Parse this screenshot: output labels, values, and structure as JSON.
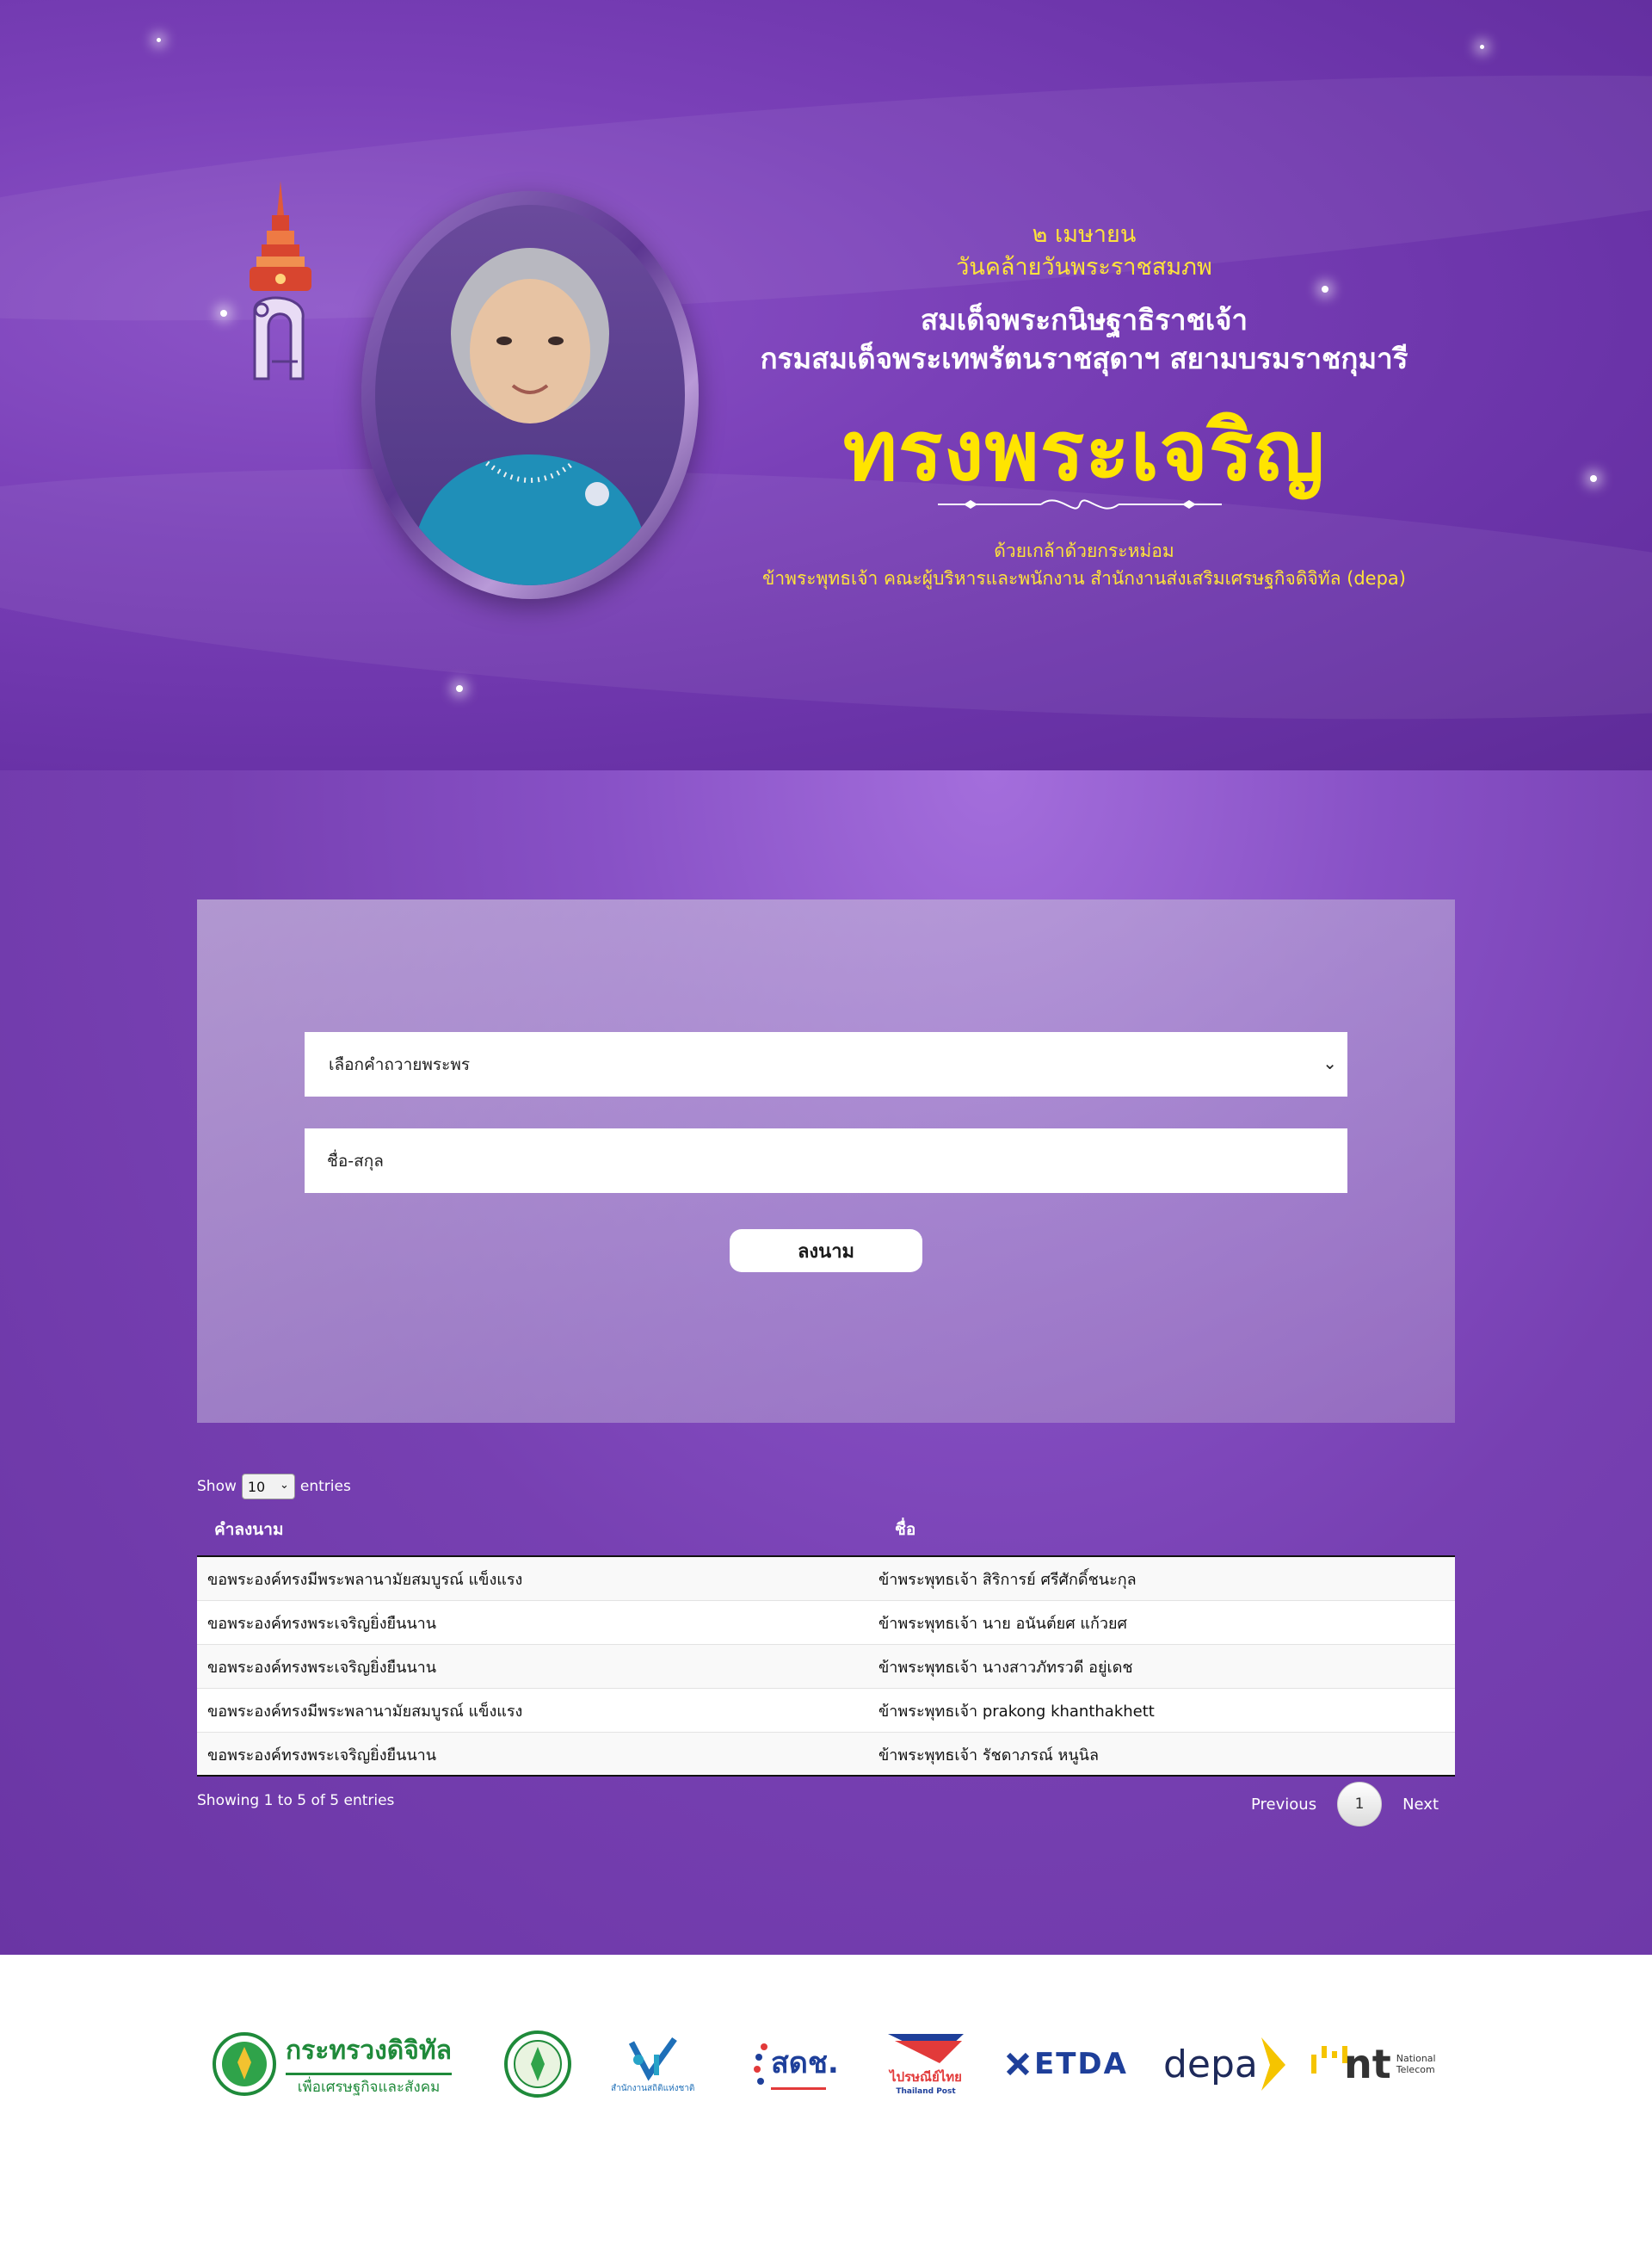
{
  "hero": {
    "date": "๒ เมษายน",
    "occasion": "วันคล้ายวันพระราชสมภพ",
    "name_line1": "สมเด็จพระกนิษฐาธิราชเจ้า",
    "name_line2": "กรมสมเด็จพระเทพรัตนราชสุดาฯ สยามบรมราชกุมารี",
    "main_title": "ทรงพระเจริญ",
    "dedication_line1": "ด้วยเกล้าด้วยกระหม่อม",
    "dedication_line2": "ข้าพระพุทธเจ้า คณะผู้บริหารและพนักงาน สำนักงานส่งเสริมเศรษฐกิจดิจิทัล (depa)"
  },
  "form": {
    "select_placeholder": "เลือกคำถวายพระพร",
    "name_placeholder": "ชื่อ-สกุล",
    "submit_label": "ลงนาม"
  },
  "table": {
    "show_label": "Show",
    "page_length": "10",
    "entries_label": "entries",
    "columns": [
      "คำลงนาม",
      "ชื่อ"
    ],
    "rows": [
      [
        "ขอพระองค์ทรงมีพระพลานามัยสมบูรณ์ แข็งแรง",
        "ข้าพระพุทธเจ้า สิริการย์ ศรีศักดิ์ชนะกุล"
      ],
      [
        "ขอพระองค์ทรงพระเจริญยิ่งยืนนาน",
        "ข้าพระพุทธเจ้า นาย อนันต์ยศ แก้วยศ"
      ],
      [
        "ขอพระองค์ทรงพระเจริญยิ่งยืนนาน",
        "ข้าพระพุทธเจ้า นางสาวภัทรวดี อยู่เดช"
      ],
      [
        "ขอพระองค์ทรงมีพระพลานามัยสมบูรณ์ แข็งแรง",
        "ข้าพระพุทธเจ้า prakong khanthakhett"
      ],
      [
        "ขอพระองค์ทรงพระเจริญยิ่งยืนนาน",
        "ข้าพระพุทธเจ้า รัชดาภรณ์ หนูนิล"
      ]
    ],
    "info": "Showing 1 to 5 of 5 entries",
    "previous_label": "Previous",
    "current_page": "1",
    "next_label": "Next"
  },
  "footer": {
    "logos": [
      {
        "icon": "ministry-digital-economy-logo",
        "title": "กระทรวงดิจิทัล",
        "subtitle": "เพื่อเศรษฐกิจและสังคม"
      },
      {
        "icon": "nso-seal-logo"
      },
      {
        "icon": "nso-statistics-logo",
        "caption": "สำนักงานสถิติแห่งชาติ"
      },
      {
        "icon": "onde-logo",
        "title": "สดช."
      },
      {
        "icon": "thailand-post-logo",
        "title": "ไปรษณีย์ไทย",
        "subtitle": "Thailand Post"
      },
      {
        "icon": "etda-logo",
        "title": "ETDA"
      },
      {
        "icon": "depa-logo",
        "title": "depa"
      },
      {
        "icon": "nt-logo",
        "title": "nt",
        "line1": "National",
        "line2": "Telecom"
      }
    ]
  },
  "colors": {
    "hero_purple": "#7a40b8",
    "title_yellow": "#ffe400",
    "accent_yellow": "#ffe33a"
  }
}
